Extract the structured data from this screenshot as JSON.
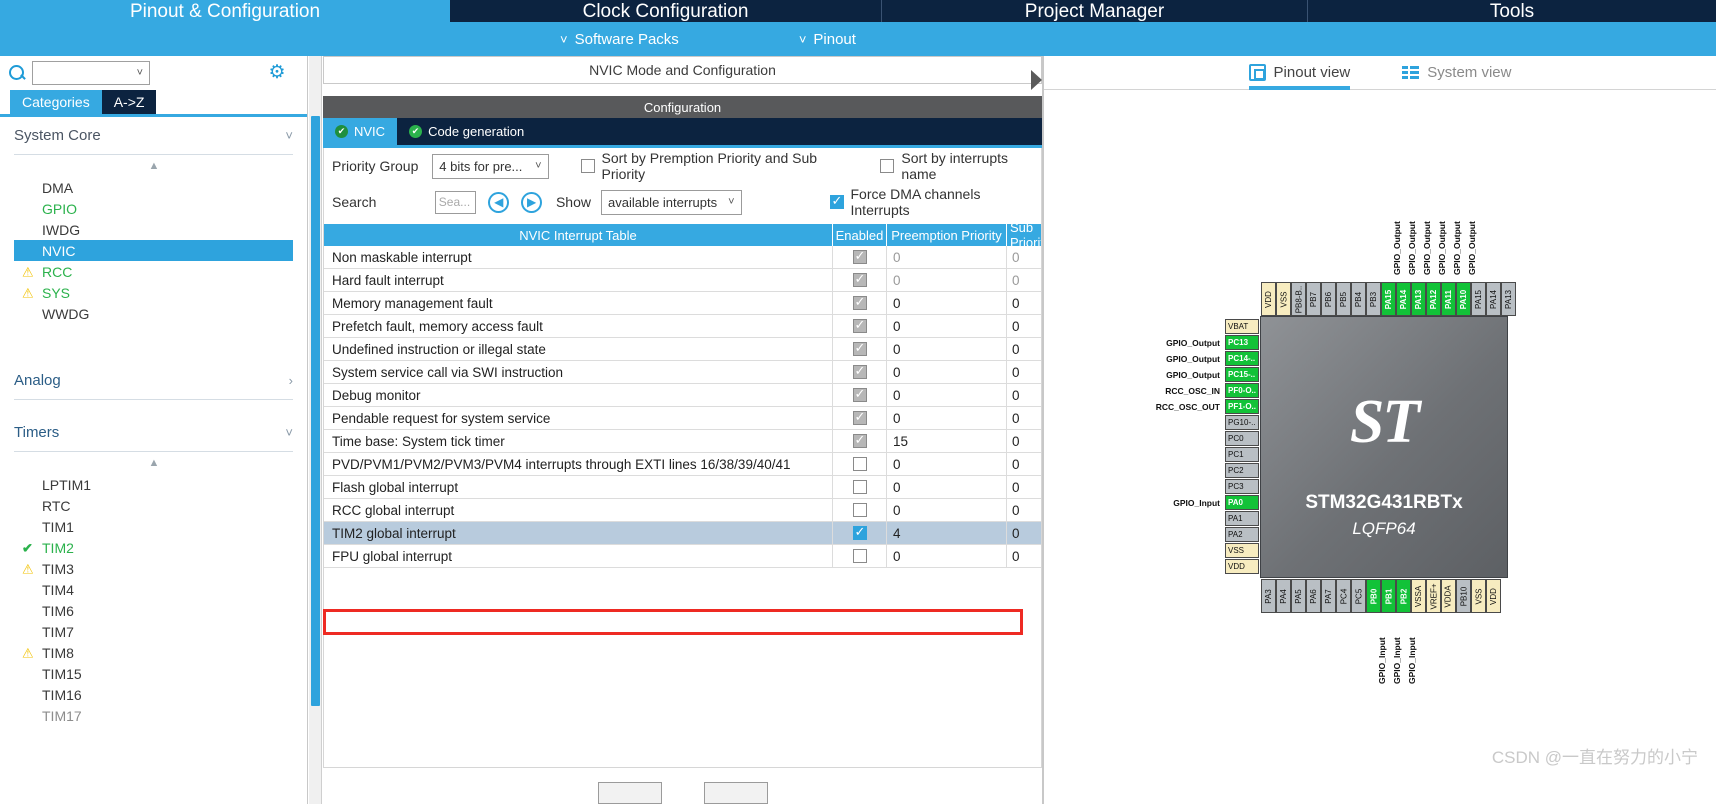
{
  "topnav": {
    "tabs": [
      {
        "label": "Pinout & Configuration",
        "active": true
      },
      {
        "label": "Clock Configuration",
        "active": false
      },
      {
        "label": "Project Manager",
        "active": false
      },
      {
        "label": "Tools",
        "active": false
      }
    ]
  },
  "subnav": {
    "items": [
      {
        "label": "Software Packs",
        "icon": "chevron-down-icon"
      },
      {
        "label": "Pinout",
        "icon": "chevron-down-icon"
      }
    ]
  },
  "sidebar": {
    "search": {
      "value": "",
      "placeholder": "",
      "icon": "search-icon"
    },
    "gear_icon": "gear-icon",
    "cat_tabs": [
      {
        "label": "Categories",
        "selected": true
      },
      {
        "label": "A->Z",
        "selected": false
      }
    ],
    "groups": [
      {
        "title": "System Core",
        "expanded": true,
        "items": [
          {
            "label": "DMA",
            "state": "normal"
          },
          {
            "label": "GPIO",
            "state": "configured"
          },
          {
            "label": "IWDG",
            "state": "normal"
          },
          {
            "label": "NVIC",
            "state": "selected"
          },
          {
            "label": "RCC",
            "state": "warning-configured"
          },
          {
            "label": "SYS",
            "state": "warning-configured"
          },
          {
            "label": "WWDG",
            "state": "normal"
          }
        ]
      },
      {
        "title": "Analog",
        "expanded": false,
        "items": []
      },
      {
        "title": "Timers",
        "expanded": true,
        "items": [
          {
            "label": "LPTIM1",
            "state": "normal"
          },
          {
            "label": "RTC",
            "state": "normal"
          },
          {
            "label": "TIM1",
            "state": "normal"
          },
          {
            "label": "TIM2",
            "state": "ok-configured"
          },
          {
            "label": "TIM3",
            "state": "warning"
          },
          {
            "label": "TIM4",
            "state": "normal"
          },
          {
            "label": "TIM6",
            "state": "normal"
          },
          {
            "label": "TIM7",
            "state": "normal"
          },
          {
            "label": "TIM8",
            "state": "warning"
          },
          {
            "label": "TIM15",
            "state": "normal"
          },
          {
            "label": "TIM16",
            "state": "normal"
          },
          {
            "label": "TIM17",
            "state": "normal"
          }
        ]
      }
    ]
  },
  "center": {
    "panel_title": "NVIC Mode and Configuration",
    "configuration_band": "Configuration",
    "tabs": [
      {
        "label": "NVIC",
        "active": true,
        "status": "ok"
      },
      {
        "label": "Code generation",
        "active": false,
        "status": "ok"
      }
    ],
    "controls": {
      "priority_group_label": "Priority Group",
      "priority_group_value": "4 bits for pre...",
      "sort_premption_label": "Sort by Premption Priority and Sub Priority",
      "sort_premption_checked": false,
      "sort_name_label": "Sort by interrupts name",
      "sort_name_checked": false,
      "search_label": "Search",
      "search_placeholder": "Sea...",
      "search_value": "",
      "prev_icon": "previous-icon",
      "next_icon": "next-icon",
      "show_label": "Show",
      "show_value": "available interrupts",
      "force_dma_label": "Force DMA channels Interrupts",
      "force_dma_checked": true
    },
    "table": {
      "headers": [
        "NVIC Interrupt Table",
        "Enabled",
        "Preemption Priority",
        "Sub Priority"
      ],
      "rows": [
        {
          "name": "Non maskable interrupt",
          "enabled": "locked",
          "preemption": "0",
          "sub": "0",
          "dim": true,
          "selected": false
        },
        {
          "name": "Hard fault interrupt",
          "enabled": "locked",
          "preemption": "0",
          "sub": "0",
          "dim": true,
          "selected": false
        },
        {
          "name": "Memory management fault",
          "enabled": "locked",
          "preemption": "0",
          "sub": "0",
          "dim": false,
          "selected": false
        },
        {
          "name": "Prefetch fault, memory access fault",
          "enabled": "locked",
          "preemption": "0",
          "sub": "0",
          "dim": false,
          "selected": false
        },
        {
          "name": "Undefined instruction or illegal state",
          "enabled": "locked",
          "preemption": "0",
          "sub": "0",
          "dim": false,
          "selected": false
        },
        {
          "name": "System service call via SWI instruction",
          "enabled": "locked",
          "preemption": "0",
          "sub": "0",
          "dim": false,
          "selected": false
        },
        {
          "name": "Debug monitor",
          "enabled": "locked",
          "preemption": "0",
          "sub": "0",
          "dim": false,
          "selected": false
        },
        {
          "name": "Pendable request for system service",
          "enabled": "locked",
          "preemption": "0",
          "sub": "0",
          "dim": false,
          "selected": false
        },
        {
          "name": "Time base: System tick timer",
          "enabled": "locked",
          "preemption": "15",
          "sub": "0",
          "dim": false,
          "selected": false
        },
        {
          "name": "PVD/PVM1/PVM2/PVM3/PVM4 interrupts through EXTI lines 16/38/39/40/41",
          "enabled": "unchecked",
          "preemption": "0",
          "sub": "0",
          "dim": false,
          "selected": false
        },
        {
          "name": "Flash global interrupt",
          "enabled": "unchecked",
          "preemption": "0",
          "sub": "0",
          "dim": false,
          "selected": false
        },
        {
          "name": "RCC global interrupt",
          "enabled": "unchecked",
          "preemption": "0",
          "sub": "0",
          "dim": false,
          "selected": false
        },
        {
          "name": "TIM2 global interrupt",
          "enabled": "checked",
          "preemption": "4",
          "sub": "0",
          "dim": false,
          "selected": true
        },
        {
          "name": "FPU global interrupt",
          "enabled": "unchecked",
          "preemption": "0",
          "sub": "0",
          "dim": false,
          "selected": false
        }
      ]
    }
  },
  "right": {
    "view_tabs": [
      {
        "label": "Pinout view",
        "active": true,
        "icon": "chip-icon"
      },
      {
        "label": "System view",
        "active": false,
        "icon": "system-view-icon"
      }
    ],
    "chip": {
      "name": "STM32G431RBTx",
      "package": "LQFP64",
      "logo": "st-logo"
    },
    "pins_left": [
      {
        "name": "VBAT",
        "type": "power",
        "signal": ""
      },
      {
        "name": "PC13",
        "type": "green",
        "signal": "GPIO_Output"
      },
      {
        "name": "PC14-..",
        "type": "green",
        "signal": "GPIO_Output"
      },
      {
        "name": "PC15-..",
        "type": "green",
        "signal": "GPIO_Output"
      },
      {
        "name": "PF0-O..",
        "type": "green",
        "signal": "RCC_OSC_IN"
      },
      {
        "name": "PF1-O..",
        "type": "green",
        "signal": "RCC_OSC_OUT"
      },
      {
        "name": "PG10-..",
        "type": "grey",
        "signal": ""
      },
      {
        "name": "PC0",
        "type": "grey",
        "signal": ""
      },
      {
        "name": "PC1",
        "type": "grey",
        "signal": ""
      },
      {
        "name": "PC2",
        "type": "grey",
        "signal": ""
      },
      {
        "name": "PC3",
        "type": "grey",
        "signal": ""
      },
      {
        "name": "PA0",
        "type": "green",
        "signal": "GPIO_Input"
      },
      {
        "name": "PA1",
        "type": "grey",
        "signal": ""
      },
      {
        "name": "PA2",
        "type": "grey",
        "signal": ""
      },
      {
        "name": "VSS",
        "type": "power",
        "signal": ""
      },
      {
        "name": "VDD",
        "type": "power",
        "signal": ""
      }
    ],
    "pins_top": [
      {
        "name": "VDD",
        "type": "power",
        "signal": ""
      },
      {
        "name": "VSS",
        "type": "power",
        "signal": ""
      },
      {
        "name": "PB8-B..",
        "type": "grey",
        "signal": ""
      },
      {
        "name": "PB7",
        "type": "grey",
        "signal": ""
      },
      {
        "name": "PB6",
        "type": "grey",
        "signal": ""
      },
      {
        "name": "PB5",
        "type": "grey",
        "signal": ""
      },
      {
        "name": "PB4",
        "type": "grey",
        "signal": ""
      },
      {
        "name": "PB3",
        "type": "grey",
        "signal": ""
      },
      {
        "name": "PA15",
        "type": "green",
        "signal": "GPIO_Output"
      },
      {
        "name": "PA14",
        "type": "green",
        "signal": "GPIO_Output"
      },
      {
        "name": "PA13",
        "type": "green",
        "signal": "GPIO_Output"
      },
      {
        "name": "PA12",
        "type": "green",
        "signal": "GPIO_Output"
      },
      {
        "name": "PA11",
        "type": "green",
        "signal": "GPIO_Output"
      },
      {
        "name": "PA10",
        "type": "green",
        "signal": "GPIO_Output"
      },
      {
        "name": "PA15",
        "type": "grey",
        "signal": ""
      },
      {
        "name": "PA14",
        "type": "grey",
        "signal": ""
      },
      {
        "name": "PA13",
        "type": "grey",
        "signal": ""
      }
    ],
    "pins_bottom": [
      {
        "name": "PA3",
        "type": "grey",
        "signal": ""
      },
      {
        "name": "PA4",
        "type": "grey",
        "signal": ""
      },
      {
        "name": "PA5",
        "type": "grey",
        "signal": ""
      },
      {
        "name": "PA6",
        "type": "grey",
        "signal": ""
      },
      {
        "name": "PA7",
        "type": "grey",
        "signal": ""
      },
      {
        "name": "PC4",
        "type": "grey",
        "signal": ""
      },
      {
        "name": "PC5",
        "type": "grey",
        "signal": ""
      },
      {
        "name": "PB0",
        "type": "green",
        "signal": "GPIO_Input"
      },
      {
        "name": "PB1",
        "type": "green",
        "signal": "GPIO_Input"
      },
      {
        "name": "PB2",
        "type": "green",
        "signal": "GPIO_Input"
      },
      {
        "name": "VSSA",
        "type": "power",
        "signal": ""
      },
      {
        "name": "VREF+",
        "type": "power",
        "signal": ""
      },
      {
        "name": "VDDA",
        "type": "power",
        "signal": ""
      },
      {
        "name": "PB10",
        "type": "grey",
        "signal": ""
      },
      {
        "name": "VSS",
        "type": "power",
        "signal": ""
      },
      {
        "name": "VDD",
        "type": "power",
        "signal": ""
      }
    ],
    "watermark": "CSDN @一直在努力的小宁"
  }
}
